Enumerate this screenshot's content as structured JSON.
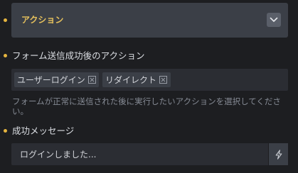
{
  "panel": {
    "title": "アクション",
    "toggle_icon": "chevron-down-icon"
  },
  "actions_field": {
    "label": "フォーム送信成功後のアクション",
    "tags": [
      {
        "label": "ユーザーログイン",
        "remove_icon": "remove-tag-icon"
      },
      {
        "label": "リダイレクト",
        "remove_icon": "remove-tag-icon"
      }
    ],
    "help": "フォームが正常に送信された後に実行したいアクションを選択してください。"
  },
  "success_message_field": {
    "label": "成功メッセージ",
    "value": "ログインしました...",
    "dynamic_icon": "dynamic-tags-icon"
  },
  "colors": {
    "accent": "#e6b53f",
    "panel_title": "#e6c15d",
    "background": "#1d1e21",
    "panel": "#3b3f47",
    "input": "#2b2d33"
  }
}
